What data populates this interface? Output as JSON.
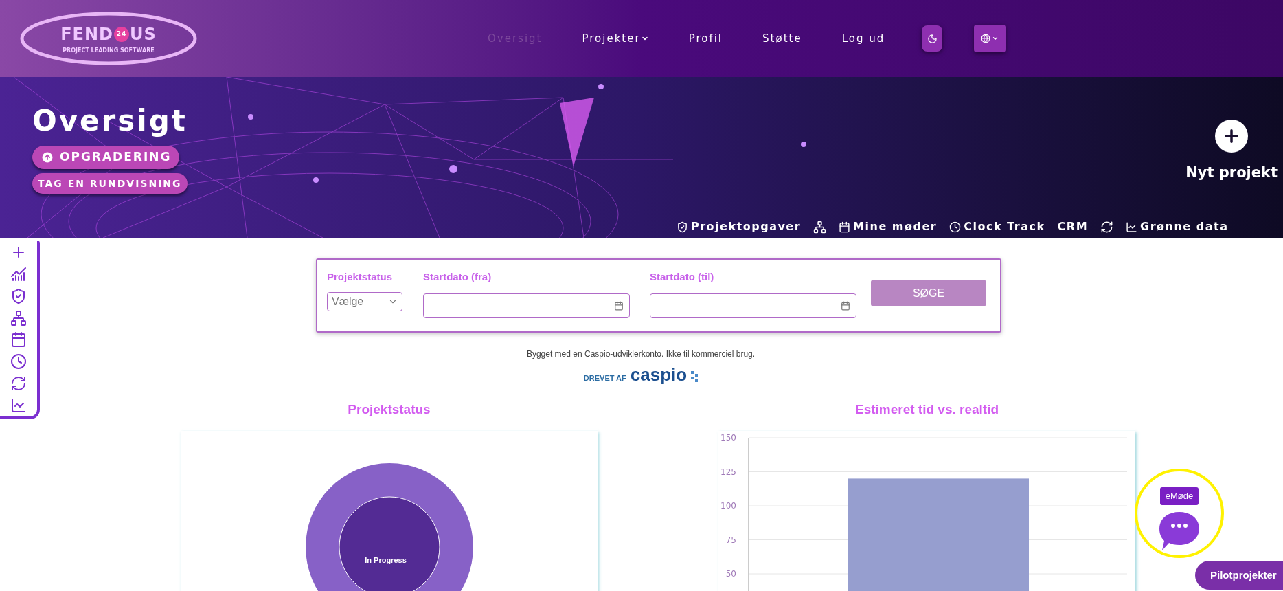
{
  "header": {
    "logo": {
      "name_start": "FEND",
      "name_end": "US",
      "badge": "24",
      "tagline": "PROJECT LEADING SOFTWARE"
    },
    "nav": [
      {
        "label": "Oversigt",
        "selected": true,
        "has_menu": false
      },
      {
        "label": "Projekter",
        "selected": false,
        "has_menu": true
      },
      {
        "label": "Profil",
        "selected": false,
        "has_menu": false
      },
      {
        "label": "Støtte",
        "selected": false,
        "has_menu": false
      },
      {
        "label": "Log ud",
        "selected": false,
        "has_menu": false
      }
    ]
  },
  "hero": {
    "title": "Oversigt",
    "buttons": [
      {
        "label": "OPGRADERING",
        "kind": "upgrade"
      },
      {
        "label": "TAG EN RUNDVISNING",
        "kind": "plain"
      }
    ],
    "new_project": {
      "label": "Nyt projekt"
    },
    "quick_links": [
      {
        "kind": "tasks",
        "label": "Projektopgaver"
      },
      {
        "kind": "hierarchy"
      },
      {
        "kind": "calendar",
        "label": "Mine møder"
      },
      {
        "kind": "clock",
        "label": "Clock Track"
      },
      {
        "kind": "text",
        "label": "CRM"
      },
      {
        "kind": "cycle"
      },
      {
        "kind": "chart",
        "label": "Grønne data"
      }
    ]
  },
  "sidebar": {
    "items": [
      {
        "kind": "plus"
      },
      {
        "kind": "trend"
      },
      {
        "kind": "tasks"
      },
      {
        "kind": "hierarchy"
      },
      {
        "kind": "calendar"
      },
      {
        "kind": "clock"
      },
      {
        "kind": "cycle"
      },
      {
        "kind": "chart"
      }
    ]
  },
  "filter": {
    "fields": [
      {
        "label": "Projektstatus",
        "kind": "select",
        "value": "Vælge"
      },
      {
        "label": "Startdato (fra)",
        "kind": "date"
      },
      {
        "label": "Startdato (til)",
        "kind": "date"
      }
    ],
    "button": "SØGE"
  },
  "footer_note": {
    "text": "Bygget med en Caspio-udviklerkonto. Ikke til kommerciel brug.",
    "powered_by": "DREVET AF",
    "brand": "caspio"
  },
  "charts": [
    {
      "title": "Projektstatus",
      "donut_label": "In Progress"
    },
    {
      "chart_data": {
        "type": "bar",
        "grid": true,
        "title": "Estimeret tid vs. realtid",
        "ylim": [
          0,
          150
        ],
        "yticks": [
          50,
          75,
          100,
          125,
          150
        ],
        "series": [
          {
            "color": "#969ecf",
            "values": [
              120
            ]
          }
        ]
      }
    }
  ],
  "chat": {
    "tag": "eMøde",
    "highlighted": true
  },
  "pilot_button": {
    "label": "Pilotprojekter"
  }
}
